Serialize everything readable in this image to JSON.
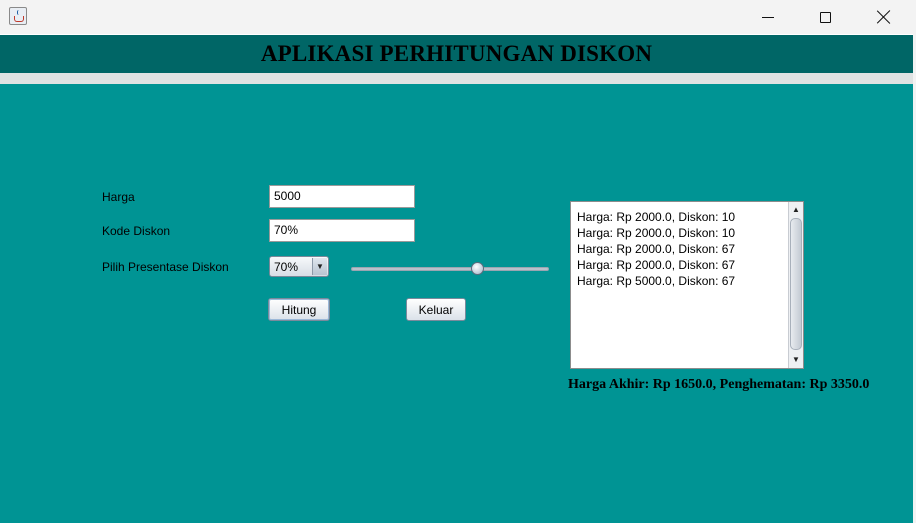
{
  "window": {
    "controls": {
      "minimize_icon": "minimize-icon",
      "maximize_icon": "maximize-icon",
      "close_icon": "close-icon"
    }
  },
  "header": {
    "title": "APLIKASI PERHITUNGAN DISKON",
    "background": "#006666"
  },
  "form": {
    "harga_label": "Harga",
    "harga_value": "5000",
    "kode_label": "Kode Diskon",
    "kode_value": "70%",
    "persen_label": "Pilih Presentase Diskon",
    "persen_selected": "70%",
    "slider_fraction": 0.65
  },
  "buttons": {
    "hitung": "Hitung",
    "keluar": "Keluar"
  },
  "history": [
    "Harga: Rp 2000.0, Diskon: 10",
    "Harga: Rp 2000.0, Diskon: 10",
    "Harga: Rp 2000.0, Diskon: 67",
    "Harga: Rp 2000.0, Diskon: 67",
    "Harga: Rp 5000.0, Diskon: 67"
  ],
  "result_text": "Harga Akhir: Rp 1650.0, Penghematan: Rp 3350.0",
  "colors": {
    "panel": "#009494",
    "header": "#006666"
  }
}
